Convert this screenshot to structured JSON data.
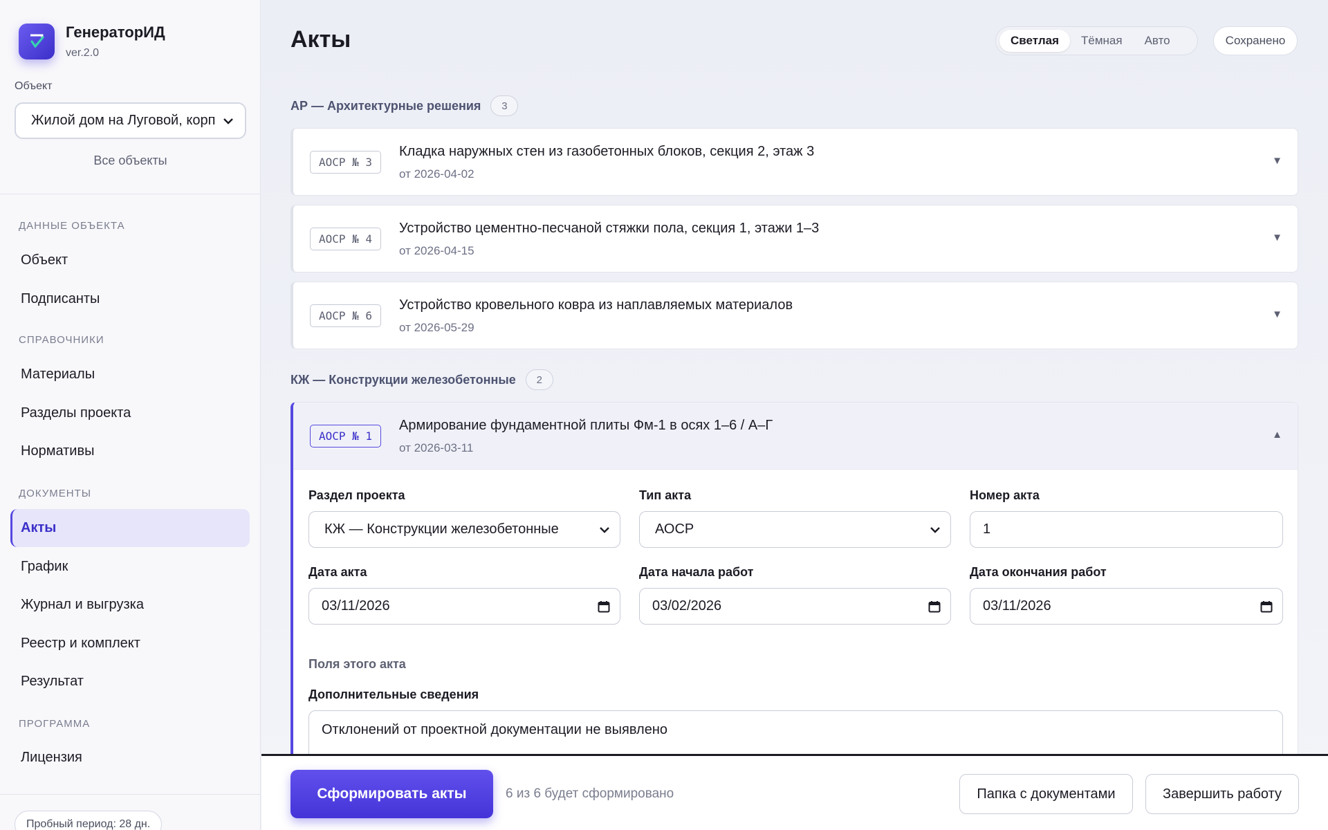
{
  "app": {
    "name": "ГенераторИД",
    "version": "ver.2.0"
  },
  "sidebar": {
    "object_label": "Объект",
    "object_value": "Жилой дом на Луговой, корп",
    "all_objects": "Все объекты",
    "sections": [
      {
        "title": "ДАННЫЕ ОБЪЕКТА",
        "items": [
          "Объект",
          "Подписанты"
        ]
      },
      {
        "title": "СПРАВОЧНИКИ",
        "items": [
          "Материалы",
          "Разделы проекта",
          "Нормативы"
        ]
      },
      {
        "title": "ДОКУМЕНТЫ",
        "items": [
          "Акты",
          "График",
          "Журнал и выгрузка",
          "Реестр и комплект",
          "Результат"
        ]
      },
      {
        "title": "ПРОГРАММА",
        "items": [
          "Лицензия"
        ]
      }
    ],
    "active_item": "Акты",
    "trial": "Пробный период: 28 дн."
  },
  "header": {
    "title": "Акты",
    "theme_options": [
      "Светлая",
      "Тёмная",
      "Авто"
    ],
    "theme_selected": "Светлая",
    "saved": "Сохранено"
  },
  "groups": [
    {
      "title": "АР — Архитектурные решения",
      "count": "3",
      "acts": [
        {
          "badge": "АОСР № 3",
          "name": "Кладка наружных стен из газобетонных блоков, секция 2, этаж 3",
          "date": "от 2026-04-02"
        },
        {
          "badge": "АОСР № 4",
          "name": "Устройство цементно-песчаной стяжки пола, секция 1, этажи 1–3",
          "date": "от 2026-04-15"
        },
        {
          "badge": "АОСР № 6",
          "name": "Устройство кровельного ковра из наплавляемых материалов",
          "date": "от 2026-05-29"
        }
      ]
    },
    {
      "title": "КЖ — Конструкции железобетонные",
      "count": "2",
      "acts": [
        {
          "badge": "АОСР № 1",
          "name": "Армирование фундаментной плиты Фм-1 в осях 1–6 / А–Г",
          "date": "от 2026-03-11",
          "expanded": true
        }
      ]
    }
  ],
  "form": {
    "section_label": "Раздел проекта",
    "section_value": "КЖ — Конструкции железобетонные",
    "type_label": "Тип акта",
    "type_value": "АОСР",
    "number_label": "Номер акта",
    "number_value": "1",
    "act_date_label": "Дата акта",
    "act_date_value": "03/11/2026",
    "start_label": "Дата начала работ",
    "start_value": "03/02/2026",
    "end_label": "Дата окончания работ",
    "end_value": "03/11/2026",
    "fields_title": "Поля этого акта",
    "extra_label": "Дополнительные сведения",
    "extra_value": "Отклонений от проектной документации не выявлено"
  },
  "footer": {
    "generate": "Сформировать акты",
    "status": "6 из 6 будет сформировано",
    "folder": "Папка с документами",
    "finish": "Завершить работу"
  },
  "colors": {
    "accent": "#5548e0",
    "accent_dark": "#3b2fc9"
  },
  "icons": [
    "logo-check-icon",
    "chevron-down-icon",
    "chevron-up-icon",
    "calendar-icon"
  ]
}
